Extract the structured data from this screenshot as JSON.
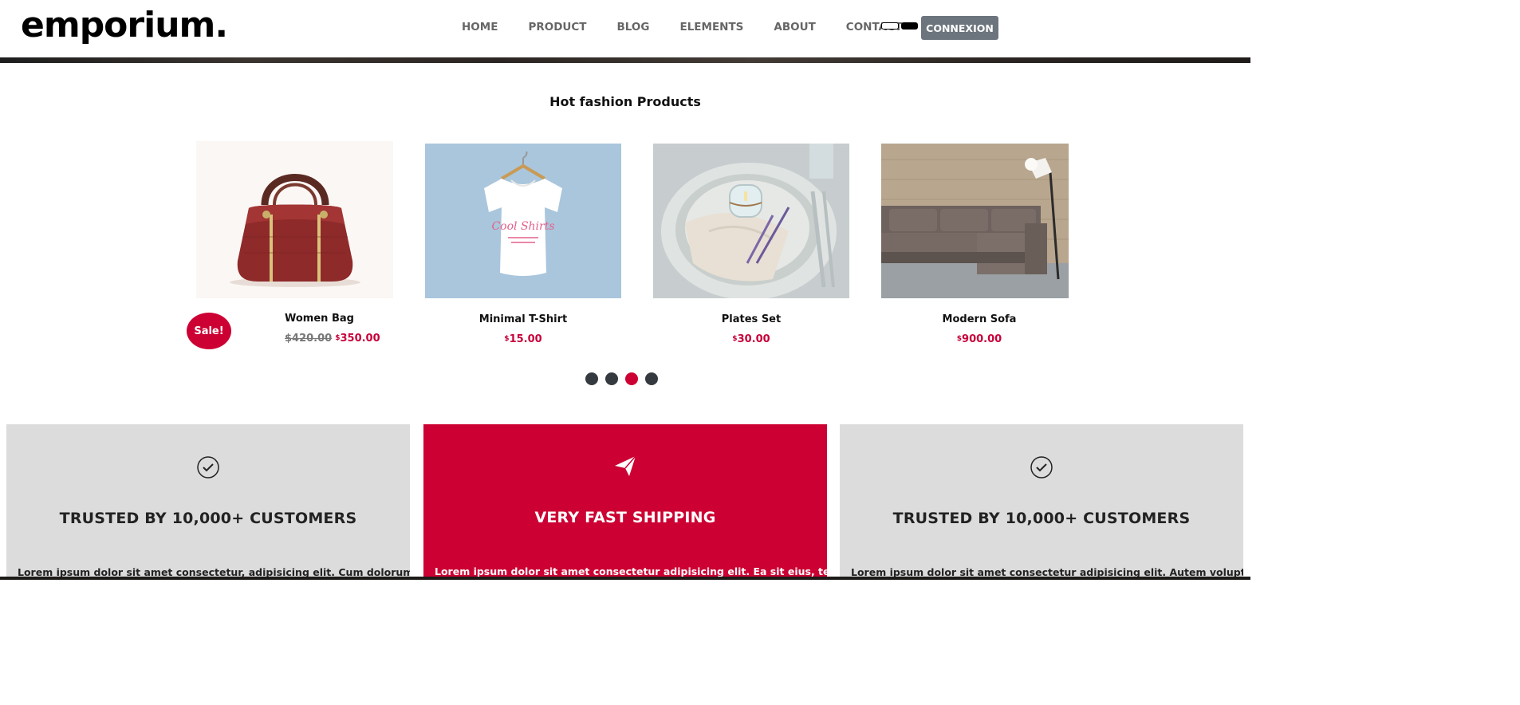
{
  "header": {
    "logo": "emporium.",
    "nav": [
      "HOME",
      "PRODUCT",
      "BLOG",
      "ELEMENTS",
      "ABOUT",
      "CONTACT"
    ],
    "login_label": "CONNEXION"
  },
  "section": {
    "title": "Hot fashion Products"
  },
  "products": [
    {
      "name": "Women Bag",
      "old_price": "$420.00",
      "currency": "$",
      "price": "350.00",
      "sale": "Sale!"
    },
    {
      "name": "Minimal T-Shirt",
      "currency": "$",
      "price": "15.00",
      "tshirt_print": "Cool Shirts"
    },
    {
      "name": "Plates Set",
      "currency": "$",
      "price": "30.00"
    },
    {
      "name": "Modern Sofa",
      "currency": "$",
      "price": "900.00"
    }
  ],
  "carousel": {
    "dots": 4,
    "active_dot": 3
  },
  "features": [
    {
      "title": "TRUSTED BY 10,000+ CUSTOMERS",
      "text": "Lorem ipsum dolor sit amet consectetur, adipisicing elit. Cum dolorum a optio",
      "icon": "check-circle-icon"
    },
    {
      "title": "VERY FAST SHIPPING",
      "text": "Lorem ipsum dolor sit amet consectetur adipisicing elit. Ea sit eius, tempore",
      "icon": "paper-plane-icon"
    },
    {
      "title": "TRUSTED BY 10,000+ CUSTOMERS",
      "text": "Lorem ipsum dolor sit amet consectetur adipisicing elit. Autem voluptatem hic",
      "icon": "check-circle-icon"
    }
  ],
  "colors": {
    "accent": "#cc0033",
    "button": "#6c757d",
    "feature_grey": "#dcdcdc"
  }
}
